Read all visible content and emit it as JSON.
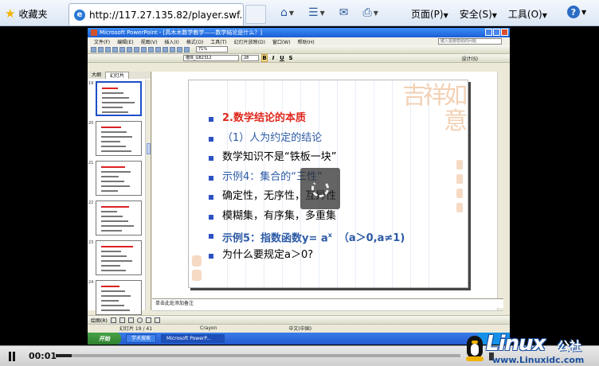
{
  "browser": {
    "favorites_label": "收藏夹",
    "tab_title": "http://117.27.135.82/player.swf...",
    "menus": [
      "页面(P)",
      "安全(S)",
      "工具(O)"
    ],
    "help_icon": "help-icon"
  },
  "powerpoint": {
    "title": "Microsoft PowerPoint - [高木木数学教学——数学结论是什么？]",
    "menus": [
      "文件(F)",
      "编辑(E)",
      "视图(V)",
      "插入(I)",
      "格式(O)",
      "工具(T)",
      "幻灯片放映(D)",
      "窗口(W)",
      "帮助(H)"
    ],
    "help_search_placeholder": "键入需要帮助的问题",
    "zoom": "71%",
    "font_name": "楷体_GB2312",
    "font_size": "28",
    "design_label": "设计(S)",
    "pane_tabs": [
      "大纲",
      "幻灯片"
    ],
    "thumbnails": [
      {
        "number": "19",
        "selected": true
      },
      {
        "number": "20",
        "selected": false
      },
      {
        "number": "21",
        "selected": false
      },
      {
        "number": "22",
        "selected": false
      },
      {
        "number": "23",
        "selected": false
      },
      {
        "number": "24",
        "selected": false
      }
    ],
    "notes_placeholder": "单击此处添加备注",
    "draw_label": "绘图(R)",
    "status": [
      "幻灯片 19 / 41",
      "Crayon",
      "中文(中国)"
    ],
    "start_label": "开始",
    "tasks": [
      "学术搜索",
      "Microsoft PowerP..."
    ],
    "tray_time": "",
    "slide": {
      "deco_text": "吉祥如意",
      "bullets": [
        {
          "text": "2.数学结论的本质",
          "style": "red"
        },
        {
          "text": "（1）人为约定的结论",
          "style": "blue"
        },
        {
          "text": "数学知识不是“铁板一块”",
          "style": "plain"
        },
        {
          "text": "示例4：集合的“三性”",
          "style": "blue"
        },
        {
          "text": "确定性，无序性，互异性",
          "style": "plain"
        },
        {
          "text": "模糊集，有序集，多重集",
          "style": "plain"
        },
        {
          "text": "示例5：指数函数y= a",
          "sup": "x",
          "tail": "（a＞0,a≠1)",
          "style": "blueb"
        },
        {
          "text": "为什么要规定a＞0?",
          "style": "plain"
        }
      ]
    }
  },
  "player": {
    "current_time": "00:01",
    "progress": 0.04,
    "remaining_time": ""
  },
  "watermark": {
    "main": "Linux",
    "cn": "公社",
    "url": "www.Linuxidc.com"
  }
}
